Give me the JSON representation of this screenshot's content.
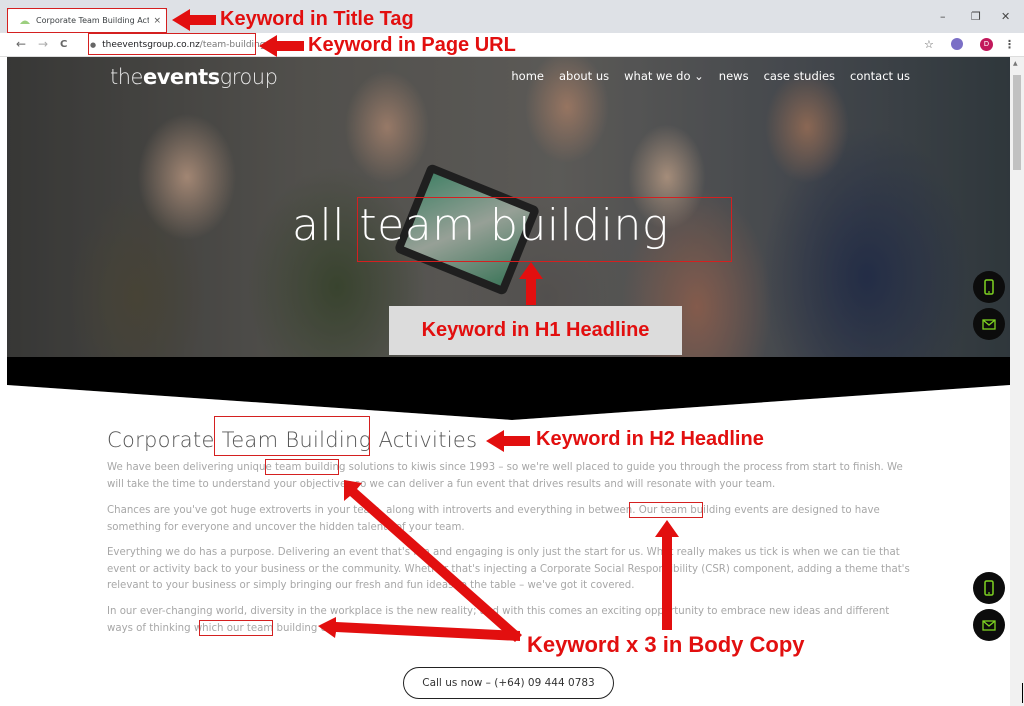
{
  "browser": {
    "tab_title": "Corporate Team Building Activiti",
    "tab_close": "×",
    "url_domain": "theeventsgroup.co.nz",
    "url_path": "/team-building/",
    "window_controls": {
      "minimize": "–",
      "maximize": "❐",
      "close": "✕"
    },
    "nav": {
      "back": "←",
      "forward": "→",
      "reload": "C"
    },
    "bookmark_icon": "☆",
    "profile_initial": "D",
    "menu_icon": "⋮"
  },
  "site": {
    "logo_prefix": "the",
    "logo_bold": "events",
    "logo_suffix": "group",
    "nav": [
      {
        "label": "home"
      },
      {
        "label": "about us"
      },
      {
        "label": "what we do ⌄"
      },
      {
        "label": "news"
      },
      {
        "label": "case studies"
      },
      {
        "label": "contact us"
      }
    ],
    "hero_title": "all team building",
    "accent_color": "#7ed321"
  },
  "content": {
    "h2": "Corporate Team Building Activities",
    "paragraphs": [
      "We have been delivering unique team building solutions to kiwis since 1993 – so we're well placed to guide you through the process from start to finish. We will take the time to understand your objectives so we can deliver a fun event that drives results and will resonate with your team.",
      "Chances are you've got huge extroverts in your team, along with introverts and everything in between. Our team building events are designed to have something for everyone and uncover the hidden talents of your team.",
      "Everything we do has a purpose. Delivering an event that's fun and engaging is only just the start for us. What really makes us tick is when we can tie that event or activity back to your business or the community. Whether that's injecting a Corporate Social Responsibility (CSR) component, adding a theme that's relevant to your business or simply bringing our fresh and fun ideas to the table – we've got it covered.",
      "In our ever-changing world, diversity in the workplace is the new reality; and with this comes an exciting opportunity to embrace new ideas and different ways of thinking which our team building events ca"
    ],
    "cta_label": "Call us now – (+64) 09 444 0783"
  },
  "annotations": {
    "title_tag": "Keyword in Title Tag",
    "page_url": "Keyword in Page URL",
    "h1": "Keyword in H1 Headline",
    "h2": "Keyword in H2 Headline",
    "body": "Keyword x 3 in Body Copy",
    "color": "#e20f0f"
  }
}
